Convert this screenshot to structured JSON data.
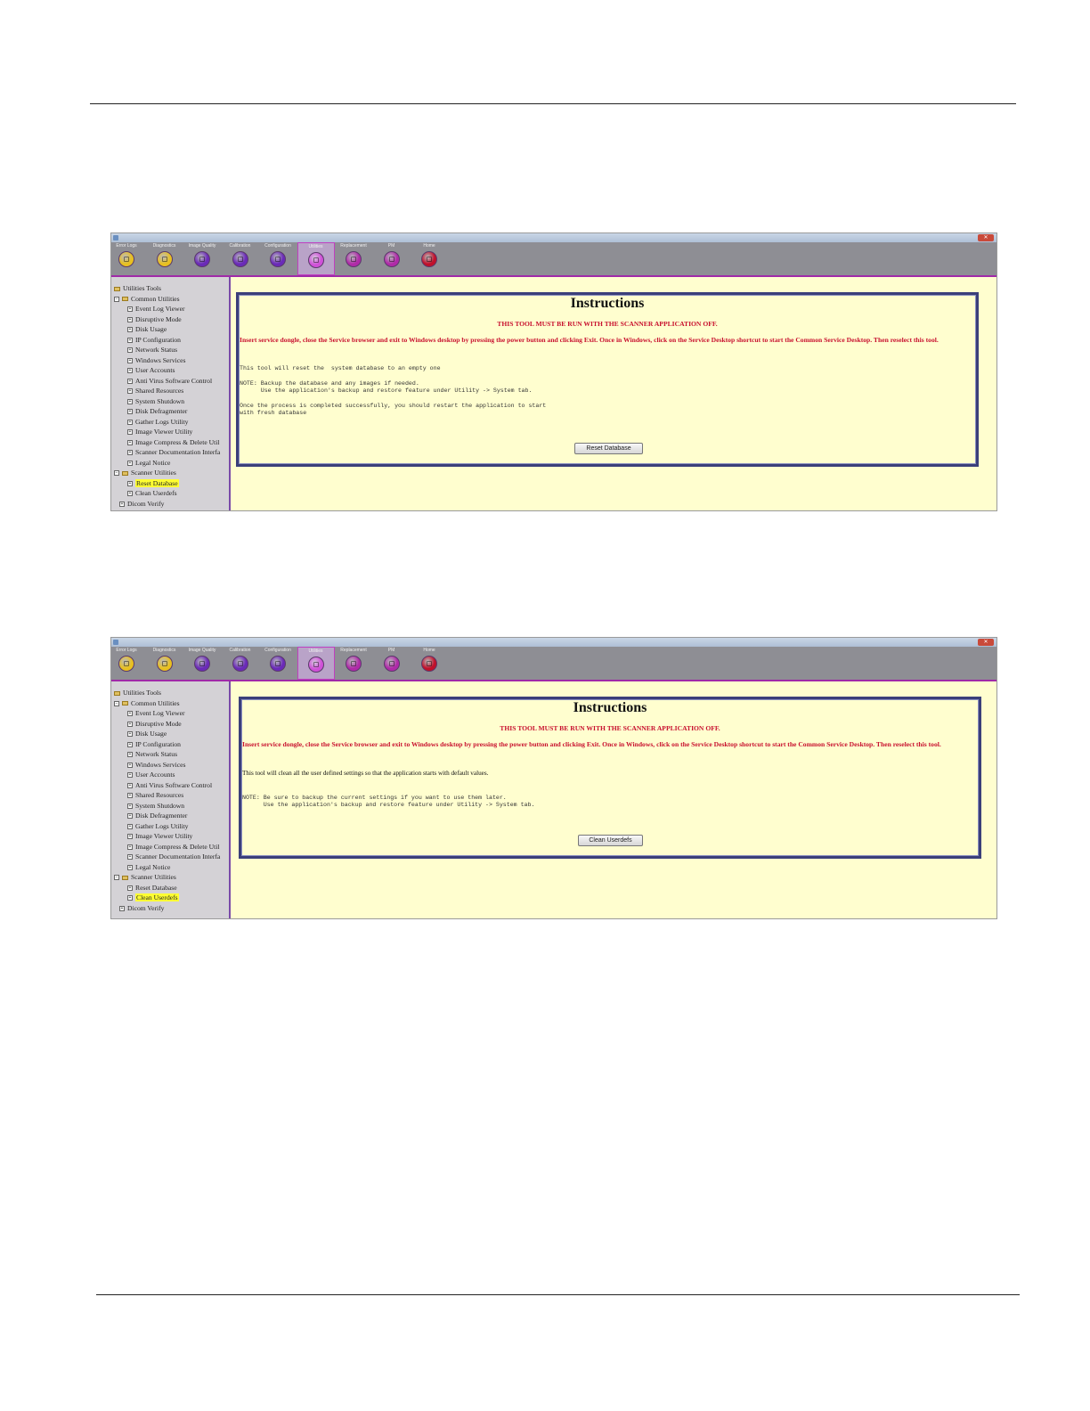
{
  "toolbar": {
    "items": [
      {
        "label": "Error Logs",
        "icon": "error-logs-icon",
        "color": "#e8c020"
      },
      {
        "label": "Diagnostics",
        "icon": "diagnostics-icon",
        "color": "#e8c020"
      },
      {
        "label": "Image Quality",
        "icon": "image-quality-icon",
        "color": "#6a2ab8"
      },
      {
        "label": "Calibration",
        "icon": "calibration-icon",
        "color": "#6a2ab8"
      },
      {
        "label": "Configuration",
        "icon": "configuration-icon",
        "color": "#6a2ab8"
      },
      {
        "label": "Utilities",
        "icon": "utilities-icon",
        "color": "#d050d8",
        "active": true
      },
      {
        "label": "Replacement",
        "icon": "replacement-icon",
        "color": "#b02aa8"
      },
      {
        "label": "PM",
        "icon": "pm-icon",
        "color": "#b02aa8"
      },
      {
        "label": "Home",
        "icon": "home-icon",
        "color": "#c0102a"
      }
    ]
  },
  "tree": {
    "root": "Utilities Tools",
    "common": "Common Utilities",
    "common_items": [
      "Event Log Viewer",
      "Disruptive Mode",
      "Disk Usage",
      "IP Configuration",
      "Network Status",
      "Windows Services",
      "User Accounts",
      "Anti Virus Software Control",
      "Shared Resources",
      "System Shutdown",
      "Disk Defragmenter",
      "Gather Logs Utility",
      "Image Viewer Utility",
      "Image Compress & Delete Util",
      "Scanner Documentation Interfa",
      "Legal Notice"
    ],
    "scanner": "Scanner Utilities",
    "scanner_items": [
      "Reset Database",
      "Clean Userdefs"
    ],
    "dicom": "Dicom Verify"
  },
  "screen1": {
    "title": "Instructions",
    "warning": "THIS TOOL MUST BE RUN WITH THE SCANNER APPLICATION OFF.",
    "instructions": "Insert service dongle, close the Service browser and exit to Windows desktop by pressing the power button and clicking Exit. Once in Windows, click on the Service Desktop shortcut to start the Common Service Desktop. Then reselect this tool.",
    "line1": "This tool will reset the  system database to an empty one",
    "note": "NOTE: Backup the database and any images if needed.\n      Use the application's backup and restore feature under Utility -> System tab.",
    "after": "Once the process is completed successfully, you should restart the application to start\nwith fresh database",
    "button": "Reset Database"
  },
  "screen2": {
    "title": "Instructions",
    "warning": "THIS TOOL MUST BE RUN WITH THE SCANNER APPLICATION OFF.",
    "instructions": "Insert service dongle, close the Service browser and exit to Windows desktop by pressing the power button and clicking Exit. Once in Windows, click on the Service Desktop shortcut to start the Common Service Desktop. Then reselect this tool.",
    "line1": "This tool will clean all the user defined settings so that the application starts with default values.",
    "note": "NOTE: Be sure to backup the current settings if you want to use them later.\n      Use the application's backup and restore feature under Utility -> System tab.",
    "button": "Clean Userdefs"
  },
  "colors": {
    "panel_background": "#fffecf",
    "warning_red": "#c8102e",
    "toolbar_gray": "#8e8e94",
    "selection_yellow": "#ffff33"
  }
}
